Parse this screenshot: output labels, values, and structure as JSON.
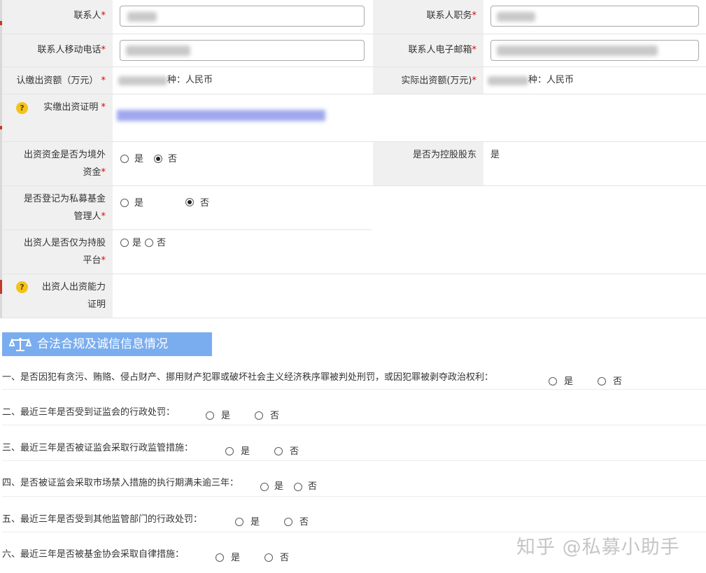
{
  "form": {
    "contact_person_label": "联系人",
    "contact_title_label": "联系人职务",
    "mobile_label": "联系人移动电话",
    "email_label": "联系人电子邮箱",
    "subscribed_label": "认缴出资额（万元）",
    "subscribed_currency": "种：人民币",
    "actual_label": "实际出资额(万元)",
    "actual_currency": "种：人民币",
    "proof_label": "实缴出资证明",
    "foreign_label_1": "出资资金是否为境外",
    "foreign_label_2": "资金",
    "controlling_label": "是否为控股股东",
    "controlling_value": "是",
    "private_fund_label_1": "是否登记为私募基金",
    "private_fund_label_2": "管理人",
    "platform_label_1": "出资人是否仅为持股",
    "platform_label_2": "平台",
    "capacity_label_1": "出资人出资能力",
    "capacity_label_2": "证明",
    "required_mark": "*",
    "help_glyph": "?",
    "yes": "是",
    "no": "否"
  },
  "radio_state": {
    "foreign_funds": "否",
    "private_fund_manager": "否",
    "holding_platform": "none"
  },
  "section": {
    "title": "合法合规及诚信信息情况",
    "icon": "scale-icon"
  },
  "questions": [
    {
      "text": "一、是否因犯有贪污、贿赂、侵占财产、挪用财产犯罪或破坏社会主义经济秩序罪被判处刑罚，或因犯罪被剥夺政治权利："
    },
    {
      "text": "二、最近三年是否受到证监会的行政处罚："
    },
    {
      "text": "三、最近三年是否被证监会采取行政监管措施："
    },
    {
      "text": "四、是否被证监会采取市场禁入措施的执行期满未逾三年："
    },
    {
      "text": "五、最近三年是否受到其他监管部门的行政处罚："
    },
    {
      "text": "六、最近三年是否被基金协会采取自律措施："
    }
  ],
  "watermark": "知乎 @私募小助手",
  "colors": {
    "section_bg": "#7aadef",
    "required": "#e00000",
    "help_icon": "#f3c319"
  }
}
